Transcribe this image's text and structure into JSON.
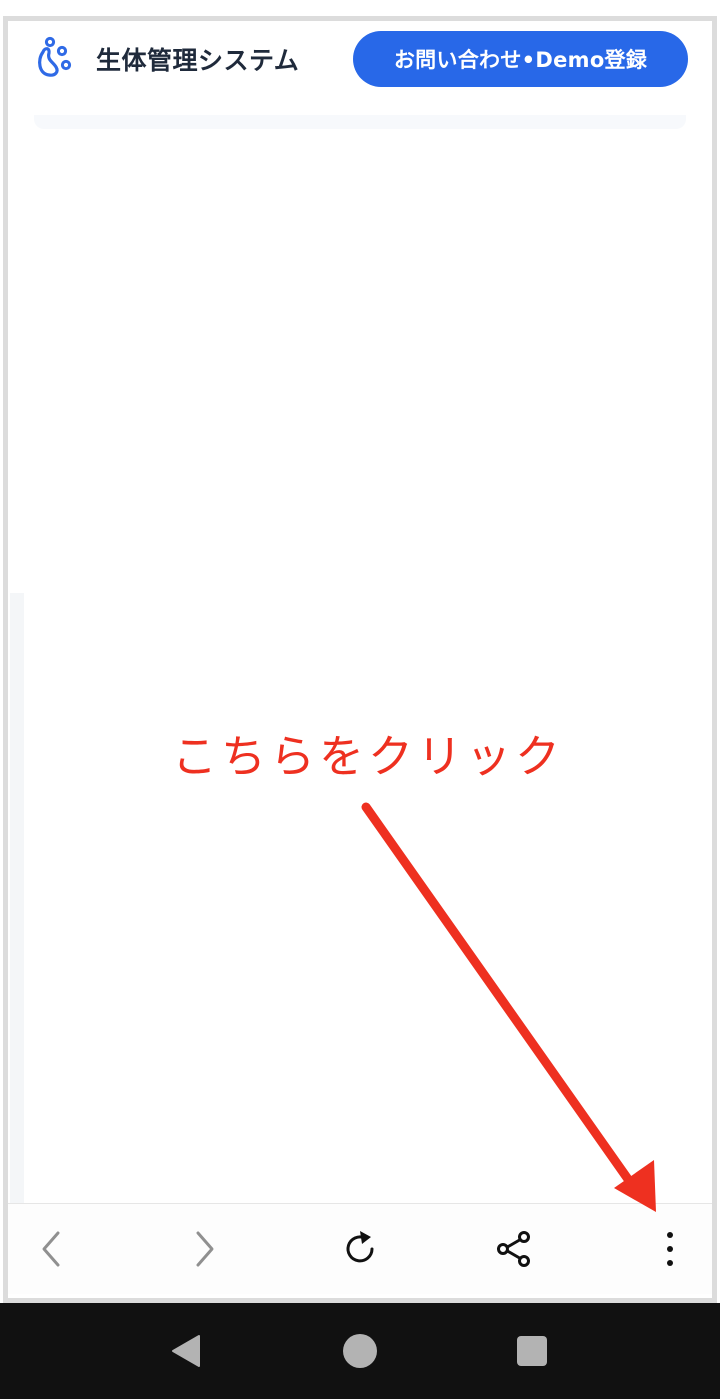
{
  "header": {
    "logo_text": "生体管理システム",
    "cta_label": "お問い合わせ•Demo登録"
  },
  "annotation": {
    "text": "こちらをクリック",
    "color": "#ee3020"
  },
  "toolbar": {
    "icons": [
      "back-icon",
      "forward-icon",
      "reload-icon",
      "share-icon",
      "more-menu-icon"
    ]
  },
  "system_nav": {
    "icons": [
      "back-triangle-icon",
      "home-circle-icon",
      "recents-square-icon"
    ]
  },
  "colors": {
    "brand_blue": "#2868e8",
    "annotation_red": "#ee3020"
  }
}
